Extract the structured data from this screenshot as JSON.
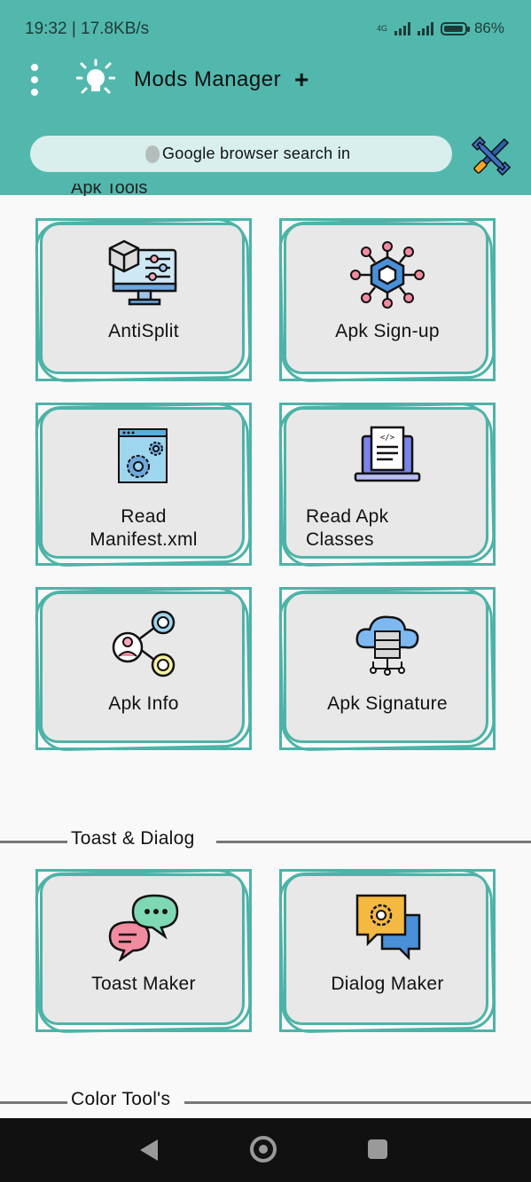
{
  "status_bar": {
    "time_speed": "19:32 | 17.8KB/s",
    "network": "4G",
    "battery": "86%"
  },
  "app_bar": {
    "title": "Mods Manager",
    "plus": "+"
  },
  "search": {
    "text": "Google browser search in"
  },
  "cut_section_title": "Apk Tools",
  "apk_tools": [
    {
      "label": "AntiSplit",
      "icon": "antisplit-monitor-icon"
    },
    {
      "label": "Apk Sign-up",
      "icon": "hexagon-network-icon"
    },
    {
      "label": "Read Manifest.xml",
      "icon": "settings-window-icon"
    },
    {
      "label": "Read Apk Classes",
      "icon": "laptop-code-icon"
    },
    {
      "label": "Apk Info",
      "icon": "share-nodes-icon"
    },
    {
      "label": "Apk Signature",
      "icon": "cloud-server-icon"
    }
  ],
  "toast_section": {
    "title": "Toast & Dialog",
    "items": [
      {
        "label": "Toast Maker",
        "icon": "chat-bubbles-icon"
      },
      {
        "label": "Dialog Maker",
        "icon": "dialog-gear-icon"
      }
    ]
  },
  "color_section": {
    "title": "Color Tool's"
  },
  "colors": {
    "accent": "#52b8ad",
    "card_bg": "#e8e8e8",
    "card_border": "#4db3a8"
  }
}
